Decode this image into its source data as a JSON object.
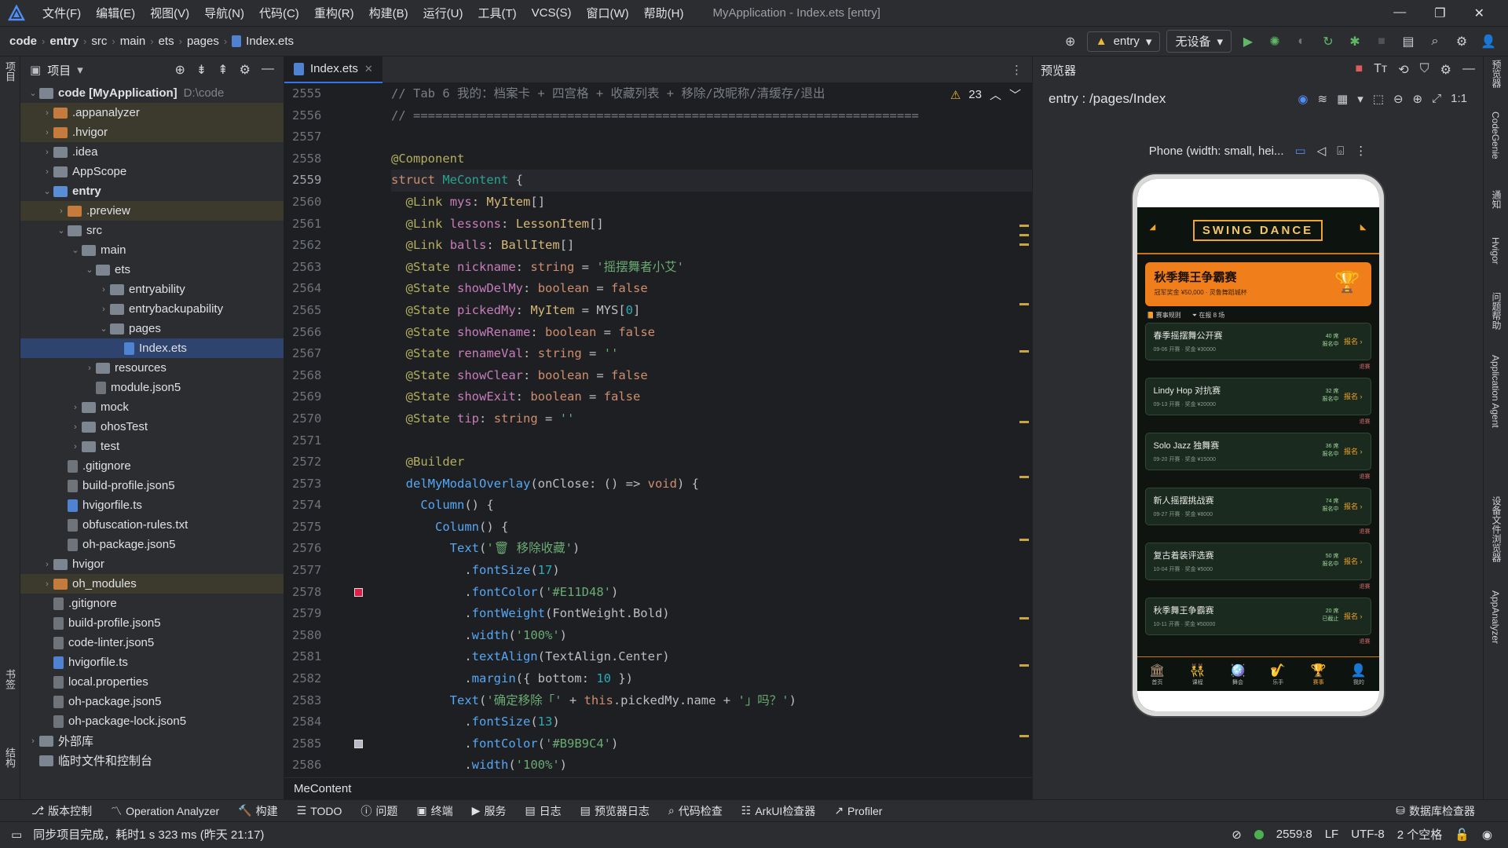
{
  "titlebar": {
    "menus": [
      "文件(F)",
      "编辑(E)",
      "视图(V)",
      "导航(N)",
      "代码(C)",
      "重构(R)",
      "构建(B)",
      "运行(U)",
      "工具(T)",
      "VCS(S)",
      "窗口(W)",
      "帮助(H)"
    ],
    "window_title": "MyApplication - Index.ets [entry]"
  },
  "navbar": {
    "breadcrumbs": [
      "code",
      "entry",
      "src",
      "main",
      "ets",
      "pages",
      "Index.ets"
    ],
    "module": "entry",
    "device": "无设备"
  },
  "left_strip": {
    "project_tab": "项目",
    "bookmarks_tab": "书签",
    "structure_tab": "结构"
  },
  "project": {
    "title": "项目",
    "tree": [
      {
        "depth": 0,
        "arrow": "⌄",
        "icon": "folder",
        "name": "code [MyApplication]",
        "hint": "D:\\code",
        "bold": true
      },
      {
        "depth": 1,
        "arrow": "›",
        "icon": "folder-orange",
        "name": ".appanalyzer",
        "ex": true
      },
      {
        "depth": 1,
        "arrow": "›",
        "icon": "folder-orange",
        "name": ".hvigor",
        "ex": true
      },
      {
        "depth": 1,
        "arrow": "›",
        "icon": "folder",
        "name": ".idea"
      },
      {
        "depth": 1,
        "arrow": "›",
        "icon": "folder",
        "name": "AppScope"
      },
      {
        "depth": 1,
        "arrow": "⌄",
        "icon": "folder-blue",
        "name": "entry",
        "bold": true
      },
      {
        "depth": 2,
        "arrow": "›",
        "icon": "folder-orange",
        "name": ".preview",
        "ex": true
      },
      {
        "depth": 2,
        "arrow": "⌄",
        "icon": "folder",
        "name": "src"
      },
      {
        "depth": 3,
        "arrow": "⌄",
        "icon": "folder",
        "name": "main"
      },
      {
        "depth": 4,
        "arrow": "⌄",
        "icon": "folder",
        "name": "ets"
      },
      {
        "depth": 5,
        "arrow": "›",
        "icon": "folder",
        "name": "entryability"
      },
      {
        "depth": 5,
        "arrow": "›",
        "icon": "folder",
        "name": "entrybackupability"
      },
      {
        "depth": 5,
        "arrow": "⌄",
        "icon": "folder",
        "name": "pages"
      },
      {
        "depth": 6,
        "arrow": "",
        "icon": "file-blue",
        "name": "Index.ets",
        "sel": true
      },
      {
        "depth": 4,
        "arrow": "›",
        "icon": "folder",
        "name": "resources"
      },
      {
        "depth": 4,
        "arrow": "",
        "icon": "file",
        "name": "module.json5"
      },
      {
        "depth": 3,
        "arrow": "›",
        "icon": "folder",
        "name": "mock"
      },
      {
        "depth": 3,
        "arrow": "›",
        "icon": "folder",
        "name": "ohosTest"
      },
      {
        "depth": 3,
        "arrow": "›",
        "icon": "folder",
        "name": "test"
      },
      {
        "depth": 2,
        "arrow": "",
        "icon": "file",
        "name": ".gitignore"
      },
      {
        "depth": 2,
        "arrow": "",
        "icon": "file",
        "name": "build-profile.json5"
      },
      {
        "depth": 2,
        "arrow": "",
        "icon": "file-blue",
        "name": "hvigorfile.ts"
      },
      {
        "depth": 2,
        "arrow": "",
        "icon": "file",
        "name": "obfuscation-rules.txt"
      },
      {
        "depth": 2,
        "arrow": "",
        "icon": "file",
        "name": "oh-package.json5"
      },
      {
        "depth": 1,
        "arrow": "›",
        "icon": "folder",
        "name": "hvigor"
      },
      {
        "depth": 1,
        "arrow": "›",
        "icon": "folder-orange",
        "name": "oh_modules",
        "ex": true
      },
      {
        "depth": 1,
        "arrow": "",
        "icon": "file",
        "name": ".gitignore"
      },
      {
        "depth": 1,
        "arrow": "",
        "icon": "file",
        "name": "build-profile.json5"
      },
      {
        "depth": 1,
        "arrow": "",
        "icon": "file",
        "name": "code-linter.json5"
      },
      {
        "depth": 1,
        "arrow": "",
        "icon": "file-blue",
        "name": "hvigorfile.ts"
      },
      {
        "depth": 1,
        "arrow": "",
        "icon": "file",
        "name": "local.properties"
      },
      {
        "depth": 1,
        "arrow": "",
        "icon": "file",
        "name": "oh-package.json5"
      },
      {
        "depth": 1,
        "arrow": "",
        "icon": "file",
        "name": "oh-package-lock.json5"
      },
      {
        "depth": 0,
        "arrow": "›",
        "icon": "folder",
        "name": "外部库"
      },
      {
        "depth": 0,
        "arrow": "",
        "icon": "folder",
        "name": "临时文件和控制台"
      }
    ]
  },
  "editor": {
    "tab": "Index.ets",
    "warnings": "23",
    "current_line": 2559,
    "struct_breadcrumb": "MeContent",
    "lines": [
      {
        "n": 2555,
        "html": "<span class=\"cm\">// Tab 6 我的：档案卡 + 四宫格 + 收藏列表 + 移除/改昵称/清缓存/退出</span>"
      },
      {
        "n": 2556,
        "html": "<span class=\"cm\">// =====================================================================</span>"
      },
      {
        "n": 2557,
        "html": ""
      },
      {
        "n": 2558,
        "html": "<span class=\"an\">@Component</span>"
      },
      {
        "n": 2559,
        "html": "<span class=\"kw\">struct</span> <span class=\"sname\">MeContent</span> {"
      },
      {
        "n": 2560,
        "html": "  <span class=\"an\">@Link</span> <span class=\"prop\">mys</span>: <span class=\"ty\">MyItem</span>[]"
      },
      {
        "n": 2561,
        "html": "  <span class=\"an\">@Link</span> <span class=\"prop\">lessons</span>: <span class=\"ty\">LessonItem</span>[]"
      },
      {
        "n": 2562,
        "html": "  <span class=\"an\">@Link</span> <span class=\"prop\">balls</span>: <span class=\"ty\">BallItem</span>[]"
      },
      {
        "n": 2563,
        "html": "  <span class=\"an\">@State</span> <span class=\"prop\">nickname</span>: <span class=\"kw\">string</span> = <span class=\"str\">'摇摆舞者小艾'</span>"
      },
      {
        "n": 2564,
        "html": "  <span class=\"an\">@State</span> <span class=\"prop\">showDelMy</span>: <span class=\"kw\">boolean</span> = <span class=\"kw\">false</span>"
      },
      {
        "n": 2565,
        "html": "  <span class=\"an\">@State</span> <span class=\"prop\">pickedMy</span>: <span class=\"ty\">MyItem</span> = MYS[<span class=\"num\">0</span>]"
      },
      {
        "n": 2566,
        "html": "  <span class=\"an\">@State</span> <span class=\"prop\">showRename</span>: <span class=\"kw\">boolean</span> = <span class=\"kw\">false</span>"
      },
      {
        "n": 2567,
        "html": "  <span class=\"an\">@State</span> <span class=\"prop\">renameVal</span>: <span class=\"kw\">string</span> = <span class=\"str\">''</span>"
      },
      {
        "n": 2568,
        "html": "  <span class=\"an\">@State</span> <span class=\"prop\">showClear</span>: <span class=\"kw\">boolean</span> = <span class=\"kw\">false</span>"
      },
      {
        "n": 2569,
        "html": "  <span class=\"an\">@State</span> <span class=\"prop\">showExit</span>: <span class=\"kw\">boolean</span> = <span class=\"kw\">false</span>"
      },
      {
        "n": 2570,
        "html": "  <span class=\"an\">@State</span> <span class=\"prop\">tip</span>: <span class=\"kw\">string</span> = <span class=\"str\">''</span>"
      },
      {
        "n": 2571,
        "html": ""
      },
      {
        "n": 2572,
        "html": "  <span class=\"an\">@Builder</span>"
      },
      {
        "n": 2573,
        "html": "  <span class=\"fn\">delMyModalOverlay</span>(onClose: () => <span class=\"kw\">void</span>) {"
      },
      {
        "n": 2574,
        "html": "    <span class=\"fn\">Column</span>() {"
      },
      {
        "n": 2575,
        "html": "      <span class=\"fn\">Column</span>() {"
      },
      {
        "n": 2576,
        "html": "        <span class=\"fn\">Text</span>(<span class=\"str\">'🗑 移除收藏'</span>)"
      },
      {
        "n": 2577,
        "html": "          .<span class=\"fn\">fontSize</span>(<span class=\"num\">17</span>)"
      },
      {
        "n": 2578,
        "html": "          .<span class=\"fn\">fontColor</span>(<span class=\"str\">'#E11D48'</span>)"
      },
      {
        "n": 2579,
        "html": "          .<span class=\"fn\">fontWeight</span>(FontWeight.Bold)"
      },
      {
        "n": 2580,
        "html": "          .<span class=\"fn\">width</span>(<span class=\"str\">'100%'</span>)"
      },
      {
        "n": 2581,
        "html": "          .<span class=\"fn\">textAlign</span>(TextAlign.Center)"
      },
      {
        "n": 2582,
        "html": "          .<span class=\"fn\">margin</span>({ bottom: <span class=\"num\">10</span> })"
      },
      {
        "n": 2583,
        "html": "        <span class=\"fn\">Text</span>(<span class=\"str\">'确定移除「'</span> + <span class=\"kw\">this</span>.pickedMy.name + <span class=\"str\">'」吗？'</span>)"
      },
      {
        "n": 2584,
        "html": "          .<span class=\"fn\">fontSize</span>(<span class=\"num\">13</span>)"
      },
      {
        "n": 2585,
        "html": "          .<span class=\"fn\">fontColor</span>(<span class=\"str\">'#B9B9C4'</span>)"
      },
      {
        "n": 2586,
        "html": "          .<span class=\"fn\">width</span>(<span class=\"str\">'100%'</span>)"
      }
    ]
  },
  "preview": {
    "title": "预览器",
    "route": "entry : /pages/Index",
    "device_label": "Phone (width: small, hei...",
    "app": {
      "brand": "SWING DANCE",
      "hero_title": "秋季舞王争霸赛",
      "hero_sub": "冠军奖金 ¥50,000 · 灵鲁舞蹈城杯",
      "meta_rules": "赛事规则",
      "meta_count": "在报 8 场",
      "cards": [
        {
          "title": "春季摇摆舞公开赛",
          "sub": "09-06 开赛 · 奖金 ¥30000",
          "status1": "40 席",
          "status2": "报名中",
          "go": "报名 ›",
          "del": "退赛"
        },
        {
          "title": "Lindy Hop 对抗赛",
          "sub": "09-13 开赛 · 奖金 ¥20000",
          "status1": "32 席",
          "status2": "报名中",
          "go": "报名 ›",
          "del": "退赛"
        },
        {
          "title": "Solo Jazz 独舞赛",
          "sub": "09-20 开赛 · 奖金 ¥15000",
          "status1": "36 席",
          "status2": "报名中",
          "go": "报名 ›",
          "del": "退赛"
        },
        {
          "title": "新人摇摆挑战赛",
          "sub": "09-27 开赛 · 奖金 ¥8000",
          "status1": "74 席",
          "status2": "报名中",
          "go": "报名 ›",
          "del": "退赛"
        },
        {
          "title": "复古着装评选赛",
          "sub": "10-04 开赛 · 奖金 ¥5000",
          "status1": "50 席",
          "status2": "报名中",
          "go": "报名 ›",
          "del": "退赛"
        },
        {
          "title": "秋季舞王争霸赛",
          "sub": "10-11 开赛 · 奖金 ¥50000",
          "status1": "20 席",
          "status2": "已截止",
          "go": "报名 ›",
          "del": "退赛"
        }
      ],
      "tabs": [
        {
          "label": "首页",
          "icon": "🏛"
        },
        {
          "label": "课程",
          "icon": "👯"
        },
        {
          "label": "舞会",
          "icon": "🪩"
        },
        {
          "label": "乐手",
          "icon": "🎷"
        },
        {
          "label": "赛事",
          "icon": "🏆",
          "on": true
        },
        {
          "label": "我的",
          "icon": "👤"
        }
      ]
    }
  },
  "right_strip": [
    "预览器",
    "CodeGenie",
    "通知",
    "Hvigor",
    "问题帮助",
    "Application Agent",
    "设备文件浏览器",
    "AppAnalyzer"
  ],
  "toolwindows": [
    "版本控制",
    "Operation Analyzer",
    "构建",
    "TODO",
    "问题",
    "终端",
    "服务",
    "日志",
    "预览器日志",
    "代码检查",
    "ArkUI检查器",
    "Profiler"
  ],
  "toolwindow_right": "数据库检查器",
  "status": {
    "message": "同步项目完成，耗时1 s 323 ms (昨天 21:17)",
    "position": "2559:8",
    "line_sep": "LF",
    "encoding": "UTF-8",
    "indent": "2 个空格"
  }
}
